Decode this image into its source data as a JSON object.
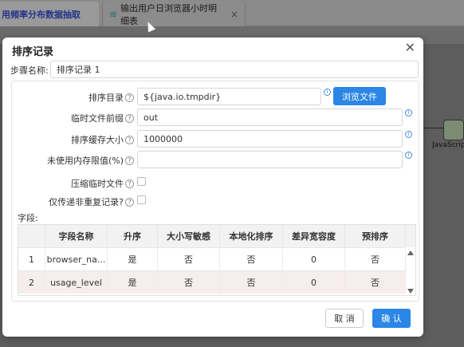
{
  "tabs": [
    {
      "label": "用频率分布数据抽取"
    },
    {
      "label": "输出用户日浏览器小时明细表"
    }
  ],
  "background": {
    "node_label": "JavaScrip"
  },
  "dialog": {
    "title": "排序记录",
    "step_name_label": "步骤名称:",
    "step_name_value": "排序记录 1",
    "fields": {
      "sort_dir_label": "排序目录",
      "sort_dir_value": "${java.io.tmpdir}",
      "browse_label": "浏览文件",
      "tmp_prefix_label": "临时文件前缀",
      "tmp_prefix_value": "out",
      "sort_size_label": "排序缓存大小",
      "sort_size_value": "1000000",
      "free_mem_label": "未使用内存限值(%)",
      "free_mem_value": "",
      "compress_label": "压缩临时文件",
      "unique_label": "仅传递非重复记录?"
    },
    "table_label": "字段:",
    "table": {
      "headers": [
        "",
        "字段名称",
        "升序",
        "大小写敏感",
        "本地化排序",
        "差异宽容度",
        "预排序"
      ],
      "rows": [
        [
          "1",
          "browser_na...",
          "是",
          "否",
          "否",
          "0",
          "否"
        ],
        [
          "2",
          "usage_level",
          "是",
          "否",
          "否",
          "0",
          "否"
        ]
      ]
    },
    "cancel_label": "取 消",
    "ok_label": "确 认"
  }
}
